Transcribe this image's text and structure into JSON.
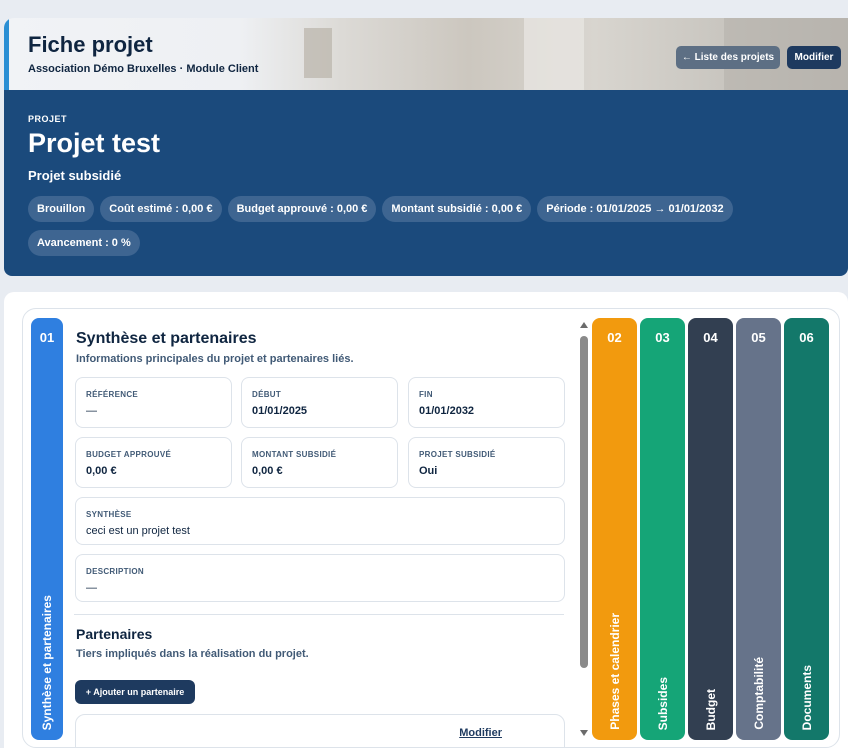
{
  "header": {
    "title": "Fiche projet",
    "subtitle": "Association Démo Bruxelles · Module Client",
    "list_button": "← Liste des projets",
    "modify_button": "Modifier"
  },
  "project": {
    "kicker": "PROJET",
    "name": "Projet test",
    "type": "Projet subsidié",
    "chips": [
      "Brouillon",
      "Coût estimé : 0,00 €",
      "Budget approuvé : 0,00 €",
      "Montant subsidié : 0,00 €",
      "Période : 01/01/2025 → 01/01/2032",
      "Avancement : 0 %"
    ]
  },
  "tabs": [
    {
      "num": "01",
      "label": "Synthèse et partenaires",
      "color": "#2f7fe0"
    },
    {
      "num": "02",
      "label": "Phases et calendrier",
      "color": "#f29a0e"
    },
    {
      "num": "03",
      "label": "Subsides",
      "color": "#15a577"
    },
    {
      "num": "04",
      "label": "Budget",
      "color": "#323f51"
    },
    {
      "num": "05",
      "label": "Comptabilité",
      "color": "#66738a"
    },
    {
      "num": "06",
      "label": "Documents",
      "color": "#13786a"
    }
  ],
  "synthese": {
    "title": "Synthèse et partenaires",
    "subtitle": "Informations principales du projet et partenaires liés.",
    "fields": {
      "reference": {
        "label": "RÉFÉRENCE",
        "value": "—"
      },
      "debut": {
        "label": "DÉBUT",
        "value": "01/01/2025"
      },
      "fin": {
        "label": "FIN",
        "value": "01/01/2032"
      },
      "budget": {
        "label": "BUDGET APPROUVÉ",
        "value": "0,00 €"
      },
      "montant": {
        "label": "MONTANT SUBSIDIÉ",
        "value": "0,00 €"
      },
      "subsidie": {
        "label": "PROJET SUBSIDIÉ",
        "value": "Oui"
      },
      "synthese": {
        "label": "SYNTHÈSE",
        "value": "ceci est un projet test"
      },
      "description": {
        "label": "DESCRIPTION",
        "value": "—"
      }
    }
  },
  "partenaires": {
    "title": "Partenaires",
    "subtitle": "Tiers impliqués dans la réalisation du projet.",
    "add_button": "+ Ajouter un partenaire",
    "edit_link": "Modifier"
  }
}
